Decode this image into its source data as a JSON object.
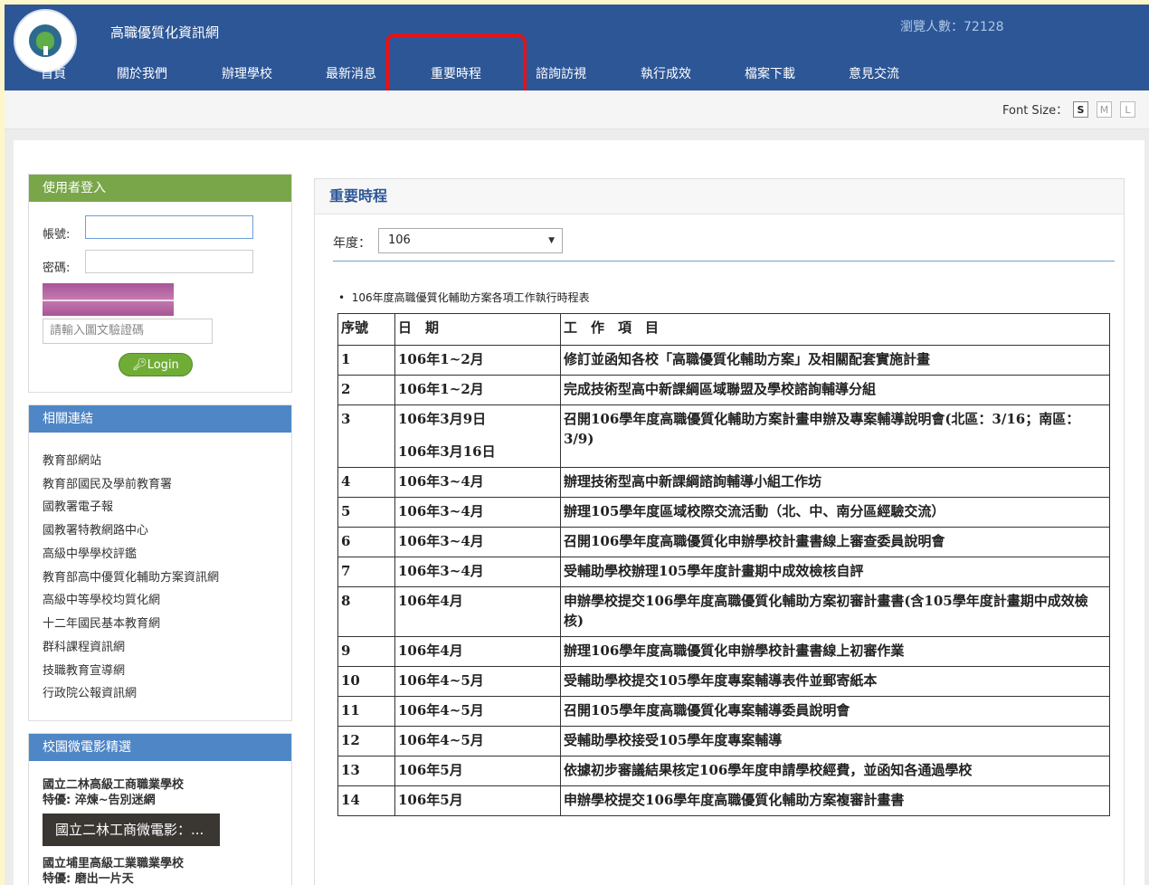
{
  "site": {
    "title": "高職優質化資訊網",
    "visitor_label": "瀏覽人數：72128"
  },
  "nav": [
    "首頁",
    "關於我們",
    "辦理學校",
    "最新消息",
    "重要時程",
    "諮詢訪視",
    "執行成效",
    "檔案下載",
    "意見交流"
  ],
  "font_size": {
    "label": "Font Size：",
    "options": [
      "S",
      "M",
      "L"
    ],
    "selected": "S"
  },
  "login": {
    "heading": "使用者登入",
    "account_label": "帳號:",
    "password_label": "密碼:",
    "captcha_placeholder": "請輸入圖文驗證碼",
    "button": "Login"
  },
  "links": {
    "heading": "相關連結",
    "items": [
      "教育部網站",
      "教育部國民及學前教育署",
      "國教署電子報",
      "國教署特教網路中心",
      "高級中學學校評鑑",
      "教育部高中優質化輔助方案資訊網",
      "高級中等學校均質化網",
      "十二年國民基本教育網",
      "群科課程資訊網",
      "技職教育宣導網",
      "行政院公報資訊網"
    ]
  },
  "movies": {
    "heading": "校園微電影精選",
    "items": [
      {
        "school": "國立二林高級工商職業學校",
        "feature": "特優: 淬煉~告別迷網",
        "thumb": "國立二林工商微電影：..."
      },
      {
        "school": "國立埔里高級工業職業學校",
        "feature": "特優: 磨出一片天"
      }
    ]
  },
  "main": {
    "heading": "重要時程",
    "year_label": "年度：",
    "year_value": "106",
    "list_title": "106年度高職優質化輔助方案各項工作執行時程表",
    "table_headers": [
      "序號",
      "日　期",
      "工　作　項　目"
    ],
    "rows": [
      {
        "no": "1",
        "date": "106年1~2月",
        "item": "修訂並函知各校「高職優質化輔助方案」及相關配套實施計畫"
      },
      {
        "no": "2",
        "date": "106年1~2月",
        "item": "完成技術型高中新課綱區域聯盟及學校諮詢輔導分組"
      },
      {
        "no": "3",
        "date": "106年3月9日",
        "date2": "106年3月16日",
        "item": "召開106學年度高職優質化輔助方案計畫申辦及專案輔導說明會(北區：3/16；南區：3/9)"
      },
      {
        "no": "4",
        "date": "106年3~4月",
        "item": "辦理技術型高中新課綱諮詢輔導小組工作坊"
      },
      {
        "no": "5",
        "date": "106年3~4月",
        "item": "辦理105學年度區域校際交流活動（北、中、南分區經驗交流）"
      },
      {
        "no": "6",
        "date": "106年3~4月",
        "item": "召開106學年度高職優質化申辦學校計畫書線上審查委員說明會"
      },
      {
        "no": "7",
        "date": "106年3~4月",
        "item": "受輔助學校辦理105學年度計畫期中成效檢核自評"
      },
      {
        "no": "8",
        "date": "106年4月",
        "item": "申辦學校提交106學年度高職優質化輔助方案初審計畫書(含105學年度計畫期中成效檢核)"
      },
      {
        "no": "9",
        "date": "106年4月",
        "item": "辦理106學年度高職優質化申辦學校計畫書線上初審作業"
      },
      {
        "no": "10",
        "date": "106年4~5月",
        "item": "受輔助學校提交105學年度專案輔導表件並郵寄紙本"
      },
      {
        "no": "11",
        "date": "106年4~5月",
        "item": "召開105學年度高職優質化專案輔導委員說明會"
      },
      {
        "no": "12",
        "date": "106年4~5月",
        "item": "受輔助學校接受105學年度專案輔導"
      },
      {
        "no": "13",
        "date": "106年5月",
        "item": "依據初步審議結果核定106學年度申請學校經費，並函知各通過學校"
      },
      {
        "no": "14",
        "date": "106年5月",
        "item": "申辦學校提交106學年度高職優質化輔助方案複審計畫書"
      }
    ]
  },
  "colors": {
    "header_bg": "#2c5696",
    "login_head": "#7aa64a",
    "links_head": "#4f86c6",
    "highlight": "#e0141b"
  }
}
